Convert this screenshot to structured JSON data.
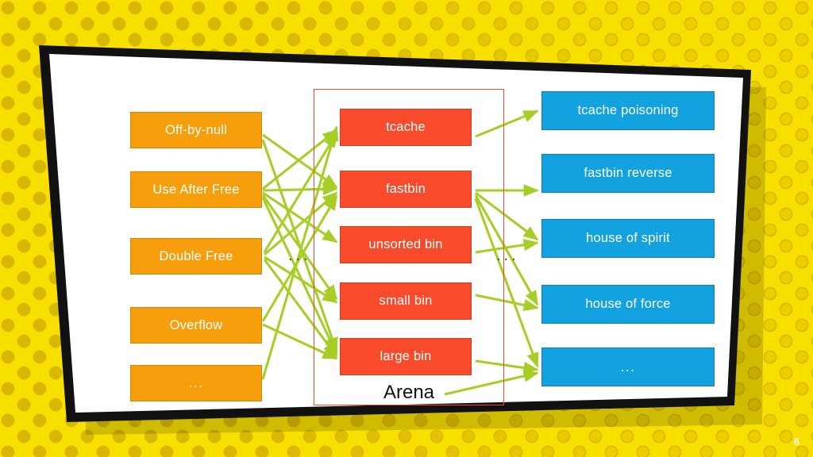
{
  "slide": {
    "page_number": "6",
    "arena_label": "Arena",
    "ellipsis_left": "...",
    "ellipsis_right": "..."
  },
  "colors": {
    "background_yellow": "#F7E000",
    "background_dot": "#D9B800",
    "card_white": "#FFFFFF",
    "card_border_black": "#111111",
    "orange": "#F69E0C",
    "red": "#F94A2B",
    "blue": "#13A2E0",
    "arrow_green": "#A6CE27",
    "arena_rect_red": "#F04B2A",
    "text_white": "#FFFFFF"
  },
  "columns": {
    "bugs": {
      "name": "bug-classes",
      "items": [
        {
          "label": "Off-by-null"
        },
        {
          "label": "Use After Free"
        },
        {
          "label": "Double Free"
        },
        {
          "label": "Overflow"
        },
        {
          "label": "..."
        }
      ]
    },
    "arena": {
      "name": "arena-bins",
      "title": "Arena",
      "items": [
        {
          "label": "tcache"
        },
        {
          "label": "fastbin"
        },
        {
          "label": "unsorted bin"
        },
        {
          "label": "small bin"
        },
        {
          "label": "large bin"
        }
      ]
    },
    "techniques": {
      "name": "exploit-techniques",
      "items": [
        {
          "label": "tcache poisoning"
        },
        {
          "label": "fastbin reverse"
        },
        {
          "label": "house of spirit"
        },
        {
          "label": "house of force"
        },
        {
          "label": "..."
        }
      ]
    }
  },
  "edges": {
    "bugs_to_bins": [
      {
        "from": "Off-by-null",
        "to": "fastbin"
      },
      {
        "from": "Off-by-null",
        "to": "large bin"
      },
      {
        "from": "Use After Free",
        "to": "tcache"
      },
      {
        "from": "Use After Free",
        "to": "fastbin"
      },
      {
        "from": "Use After Free",
        "to": "unsorted bin"
      },
      {
        "from": "Use After Free",
        "to": "small bin"
      },
      {
        "from": "Use After Free",
        "to": "large bin"
      },
      {
        "from": "Double Free",
        "to": "tcache"
      },
      {
        "from": "Double Free",
        "to": "fastbin"
      },
      {
        "from": "Double Free",
        "to": "small bin"
      },
      {
        "from": "Double Free",
        "to": "large bin"
      },
      {
        "from": "Overflow",
        "to": "fastbin"
      },
      {
        "from": "Overflow",
        "to": "large bin"
      },
      {
        "from": "...",
        "to": "tcache"
      }
    ],
    "bins_to_techniques": [
      {
        "from": "tcache",
        "to": "tcache poisoning"
      },
      {
        "from": "fastbin",
        "to": "fastbin reverse"
      },
      {
        "from": "fastbin",
        "to": "house of spirit"
      },
      {
        "from": "fastbin",
        "to": "house of force"
      },
      {
        "from": "fastbin",
        "to": "..."
      },
      {
        "from": "unsorted bin",
        "to": "house of spirit"
      },
      {
        "from": "small bin",
        "to": "house of force"
      },
      {
        "from": "large bin",
        "to": "..."
      },
      {
        "from": "Arena",
        "to": "..."
      }
    ]
  }
}
